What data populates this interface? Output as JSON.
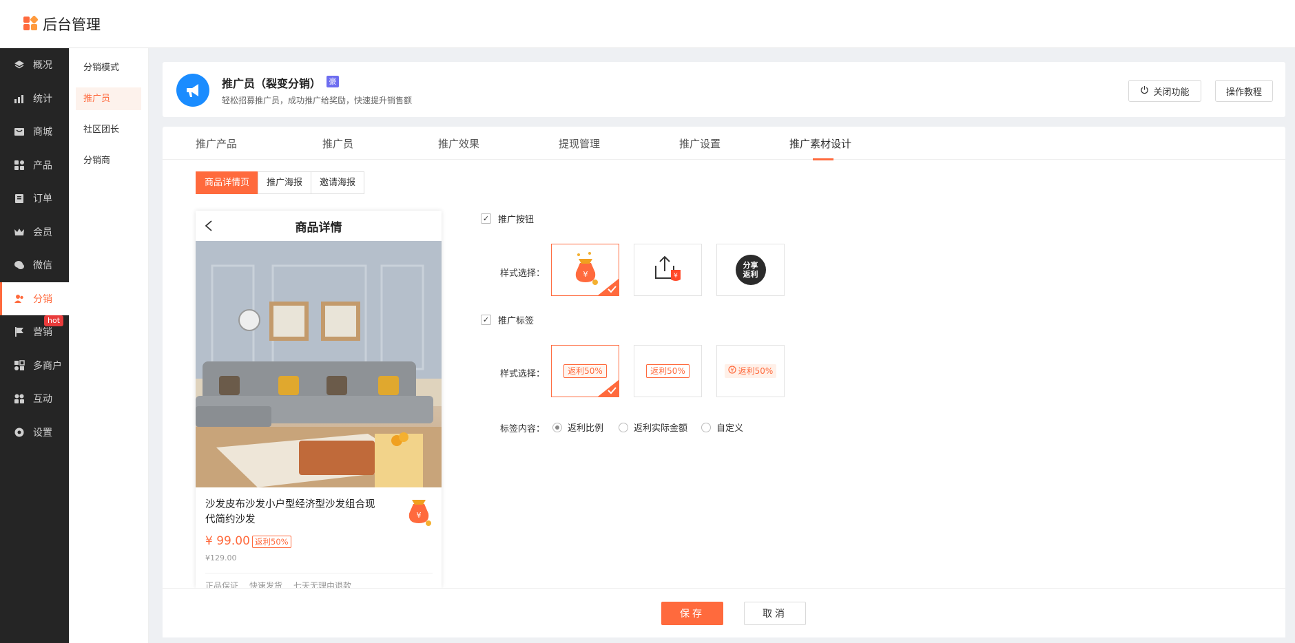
{
  "app": {
    "logo_text": "后台管理"
  },
  "sidebar": {
    "items": [
      {
        "label": "概况",
        "icon": "layers-icon"
      },
      {
        "label": "统计",
        "icon": "chart-icon"
      },
      {
        "label": "商城",
        "icon": "shop-icon"
      },
      {
        "label": "产品",
        "icon": "grid-icon"
      },
      {
        "label": "订单",
        "icon": "clipboard-icon"
      },
      {
        "label": "会员",
        "icon": "crown-icon"
      },
      {
        "label": "微信",
        "icon": "wechat-icon"
      },
      {
        "label": "分销",
        "icon": "users-icon",
        "active": true
      },
      {
        "label": "营销",
        "icon": "flag-icon",
        "badge": "hot"
      },
      {
        "label": "多商户",
        "icon": "store-icon"
      },
      {
        "label": "互动",
        "icon": "interact-icon"
      },
      {
        "label": "设置",
        "icon": "gear-icon"
      }
    ]
  },
  "subnav": {
    "items": [
      {
        "label": "分销模式"
      },
      {
        "label": "推广员",
        "active": true
      },
      {
        "label": "社区团长"
      },
      {
        "label": "分销商"
      }
    ]
  },
  "header": {
    "title": "推广员（裂变分销）",
    "tag": "豪",
    "desc": "轻松招募推广员，成功推广给奖励，快速提升销售额",
    "close_label": "关闭功能",
    "tutorial_label": "操作教程"
  },
  "tabs": [
    {
      "label": "推广产品"
    },
    {
      "label": "推广员"
    },
    {
      "label": "推广效果"
    },
    {
      "label": "提现管理"
    },
    {
      "label": "推广设置"
    },
    {
      "label": "推广素材设计",
      "active": true
    }
  ],
  "segments": [
    {
      "label": "商品详情页",
      "active": true
    },
    {
      "label": "推广海报"
    },
    {
      "label": "邀请海报"
    }
  ],
  "preview": {
    "nav_title": "商品详情",
    "product_title": "沙发皮布沙发小户型经济型沙发组合现代简约沙发",
    "price": "¥ 99.00",
    "rebate": "返利50%",
    "orig_price": "¥129.00",
    "features": [
      "正品保证",
      "快速发货",
      "七天无理由退款"
    ]
  },
  "settings": {
    "promo_button_label": "推广按钮",
    "promo_tag_label": "推广标签",
    "style_label": "样式选择：",
    "button_style3_text": "分享\n返利",
    "tag_chip_text": "返利50%",
    "tag_content_label": "标签内容：",
    "tag_content_options": [
      {
        "label": "返利比例",
        "selected": true
      },
      {
        "label": "返利实际金额"
      },
      {
        "label": "自定义"
      }
    ]
  },
  "footer": {
    "save_label": "保存",
    "cancel_label": "取消"
  },
  "colors": {
    "accent": "#ff6a3d",
    "sidebar_bg": "#252525",
    "brand_blue": "#1a8cff"
  }
}
